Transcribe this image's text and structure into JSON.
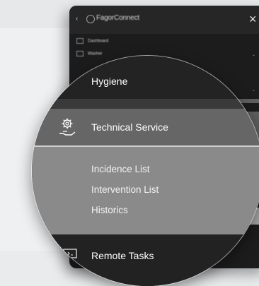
{
  "panel": {
    "brand": "FagorConnect",
    "close_icon": "×",
    "back_icon": "‹",
    "rows": [
      {
        "label": "Dashboard"
      },
      {
        "label": "Washer"
      }
    ]
  },
  "menu": {
    "hygiene": "Hygiene",
    "technical_service": "Technical Service",
    "submenu": [
      "Incidence List",
      "Intervention List",
      "Historics"
    ],
    "remote_tasks": "Remote Tasks"
  },
  "icons": {
    "technical_service": "gear-hand-icon",
    "remote_tasks": "monitor-icon",
    "close": "close-icon"
  },
  "colors": {
    "panel_bg": "#1c1c1c",
    "active_row": "#666666",
    "submenu_bg": "#8a8a8a",
    "separator": "#cfcfcf",
    "text": "#ffffff"
  }
}
